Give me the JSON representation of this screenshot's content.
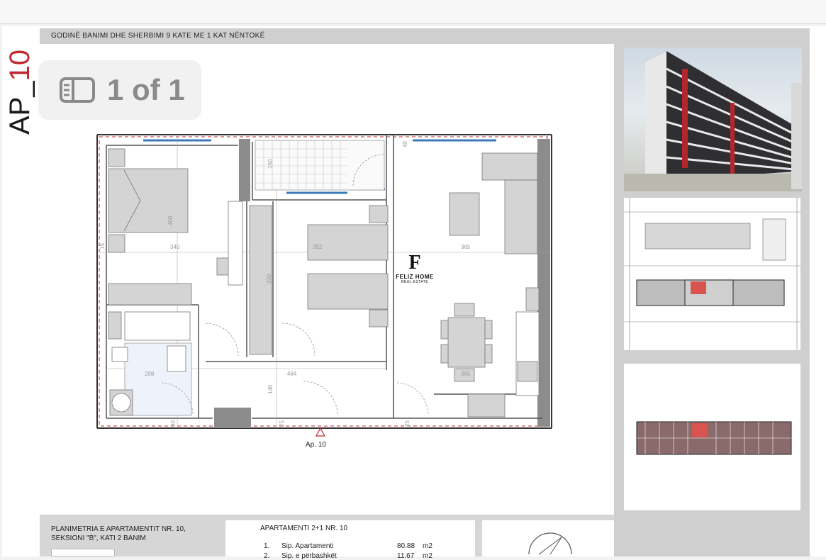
{
  "viewer": {
    "pager_text": "1 of 1"
  },
  "sheet": {
    "side_label_prefix": "AP_",
    "side_label_number": "10",
    "header_title": "GODINË BANIMI DHE SHERBIMI 9 KATE ME 1 KAT NËNTOKË",
    "apartment_caption": "Ap. 10",
    "caption_left_line1": "PLANIMETRIA E APARTAMENTIT NR. 10,",
    "caption_left_line2": "SEKSIONI \"B\", KATI 2 BANIM",
    "caption_right_title": "APARTAMENTI 2+1 NR. 10",
    "rows": [
      {
        "num": "1.",
        "label": "Sip. Apartamenti",
        "value": "80.88",
        "unit": "m2"
      },
      {
        "num": "2.",
        "label": "Sip. e përbashkët",
        "value": "11.67",
        "unit": "m2"
      }
    ]
  },
  "plan_dimensions": {
    "bedroom1_width": "340",
    "bedroom1_depth": "400",
    "bedroom2_width": "352",
    "living_width": "365",
    "living_lower": "365",
    "balcony": "150",
    "corridor_length": "484",
    "closet": "330",
    "bath_width": "208",
    "hall_depth": "140",
    "wall_a": "25",
    "wall_b": "25",
    "wall_c": "40",
    "wall_d": "15",
    "wall_e": "40"
  },
  "watermark": {
    "brand": "FELIZ HOME",
    "tagline": "REAL ESTATE"
  },
  "colors": {
    "accent_red": "#c0282d",
    "panel_grey": "#cfcfcf",
    "furniture_grey": "#d4d4d4",
    "window_blue": "#3a7ab8"
  },
  "icons": {
    "pager": "sidebar-panel-icon",
    "compass": "north-arrow-icon"
  }
}
